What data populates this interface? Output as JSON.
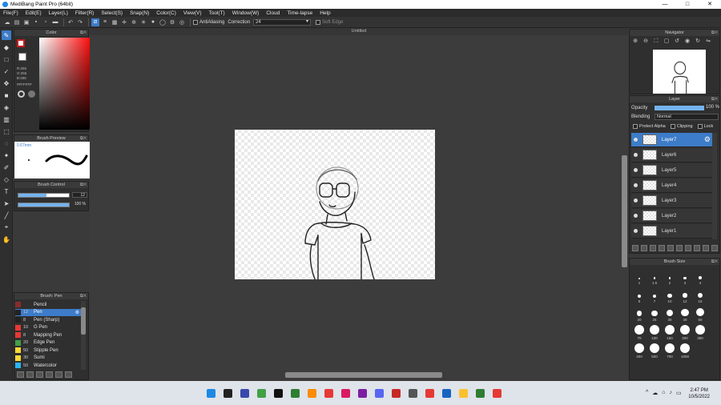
{
  "window": {
    "title": "MediBang Paint Pro (64bit)",
    "controls": [
      "—",
      "□",
      "✕"
    ]
  },
  "menu": [
    "File(F)",
    "Edit(E)",
    "Layer(L)",
    "Filter(R)",
    "Select(S)",
    "Snap(N)",
    "Color(C)",
    "View(V)",
    "Tool(T)",
    "Window(W)",
    "Cloud",
    "Time-lapse",
    "Help"
  ],
  "toolbar": {
    "antialiasing_label": "AntiAliasing",
    "correction_label": "Correction",
    "correction_value": "24",
    "soft_edge_label": "Soft Edge"
  },
  "color_panel": {
    "title": "Color",
    "r": "R:255",
    "g": "G:255",
    "b": "B:255",
    "hex": "#FFFFFF",
    "fg_border_color": "#c81e1e"
  },
  "brush_preview": {
    "title": "Brush Preview",
    "size": "0.67mm"
  },
  "brush_control": {
    "title": "Brush Control",
    "size_value": "12",
    "opacity_value": "100 %",
    "size_fill": 0.55,
    "opacity_fill": 1.0
  },
  "brush_panel": {
    "title": "Brush: Pen",
    "items": [
      {
        "num": "",
        "name": "Pencil",
        "color": "#8b2b2b"
      },
      {
        "num": "12",
        "name": "Pen",
        "color": "#222222",
        "selected": true
      },
      {
        "num": "8",
        "name": "Pen (Sharp)",
        "color": "#222222"
      },
      {
        "num": "10",
        "name": "G Pen",
        "color": "#e53935"
      },
      {
        "num": "8",
        "name": "Mapping Pen",
        "color": "#e53935"
      },
      {
        "num": "20",
        "name": "Edge Pen",
        "color": "#43a047"
      },
      {
        "num": "50",
        "name": "Stipple Pen",
        "color": "#fdd835"
      },
      {
        "num": "30",
        "name": "Sumi",
        "color": "#fdd835"
      },
      {
        "num": "50",
        "name": "Watercolor",
        "color": "#29b6f6"
      }
    ]
  },
  "canvas": {
    "title": "Untitled"
  },
  "navigator": {
    "title": "Navigator"
  },
  "layer_panel": {
    "title": "Layer",
    "opacity_label": "Opacity",
    "opacity_value": "100 %",
    "blending_label": "Blending",
    "blending_value": "Normal",
    "protect_alpha": "Protect Alpha",
    "clipping": "Clipping",
    "lock": "Lock",
    "layers": [
      "Layer7",
      "Layer6",
      "Layer5",
      "Layer4",
      "Layer3",
      "Layer2",
      "Layer1"
    ]
  },
  "brush_size": {
    "title": "Brush Size",
    "sizes": [
      "1",
      "1.5",
      "2",
      "3",
      "4",
      "5",
      "7",
      "10",
      "12",
      "15",
      "20",
      "25",
      "30",
      "40",
      "50",
      "70",
      "100",
      "150",
      "200",
      "300",
      "400",
      "500",
      "700",
      "1000"
    ]
  },
  "taskbar": {
    "time": "2:47 PM",
    "date": "10/5/2022",
    "icon_colors": [
      "#1e88e5",
      "#222",
      "#3949ab",
      "#43a047",
      "#111",
      "#2e7d32",
      "#fb8c00",
      "#e53935",
      "#d81b60",
      "#7b1fa2",
      "#5865f2",
      "#c62828",
      "#555",
      "#e53935",
      "#1565c0",
      "#fbc02d",
      "#2e7d32",
      "#e53935"
    ]
  }
}
